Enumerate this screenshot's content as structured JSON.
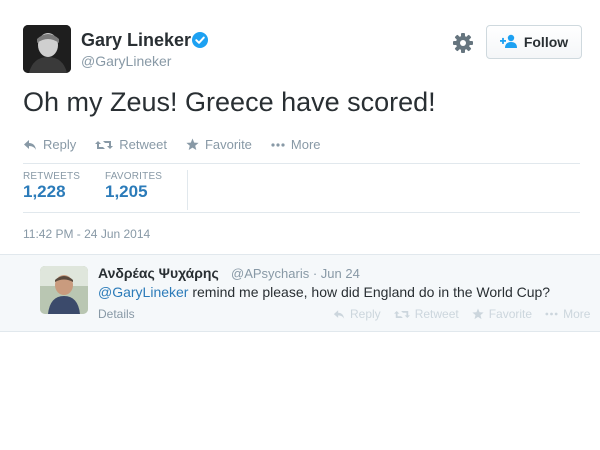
{
  "tweet": {
    "author_name": "Gary Lineker",
    "author_handle": "@GaryLineker",
    "text": "Oh my Zeus! Greece have scored!",
    "follow_label": "Follow",
    "actions": {
      "reply": "Reply",
      "retweet": "Retweet",
      "favorite": "Favorite",
      "more": "More"
    },
    "stats": {
      "retweets_label": "RETWEETS",
      "retweets_value": "1,228",
      "favorites_label": "FAVORITES",
      "favorites_value": "1,205"
    },
    "timestamp": "11:42 PM - 24 Jun 2014"
  },
  "reply": {
    "author_name": "Ανδρέας Ψυχάρης",
    "author_handle": "@APsycharis",
    "date": "· Jun 24",
    "mention": "@GaryLineker",
    "text": " remind me please, how did England do in the World Cup?",
    "details_label": "Details",
    "actions": {
      "reply": "Reply",
      "retweet": "Retweet",
      "favorite": "Favorite",
      "more": "More"
    }
  },
  "colors": {
    "link": "#2b7bb9",
    "verified": "#1da1f2",
    "muted": "#8899a6"
  },
  "icons": [
    "verified-badge-icon",
    "gear-icon",
    "add-user-icon",
    "reply-icon",
    "retweet-icon",
    "star-icon",
    "more-dots-icon"
  ]
}
